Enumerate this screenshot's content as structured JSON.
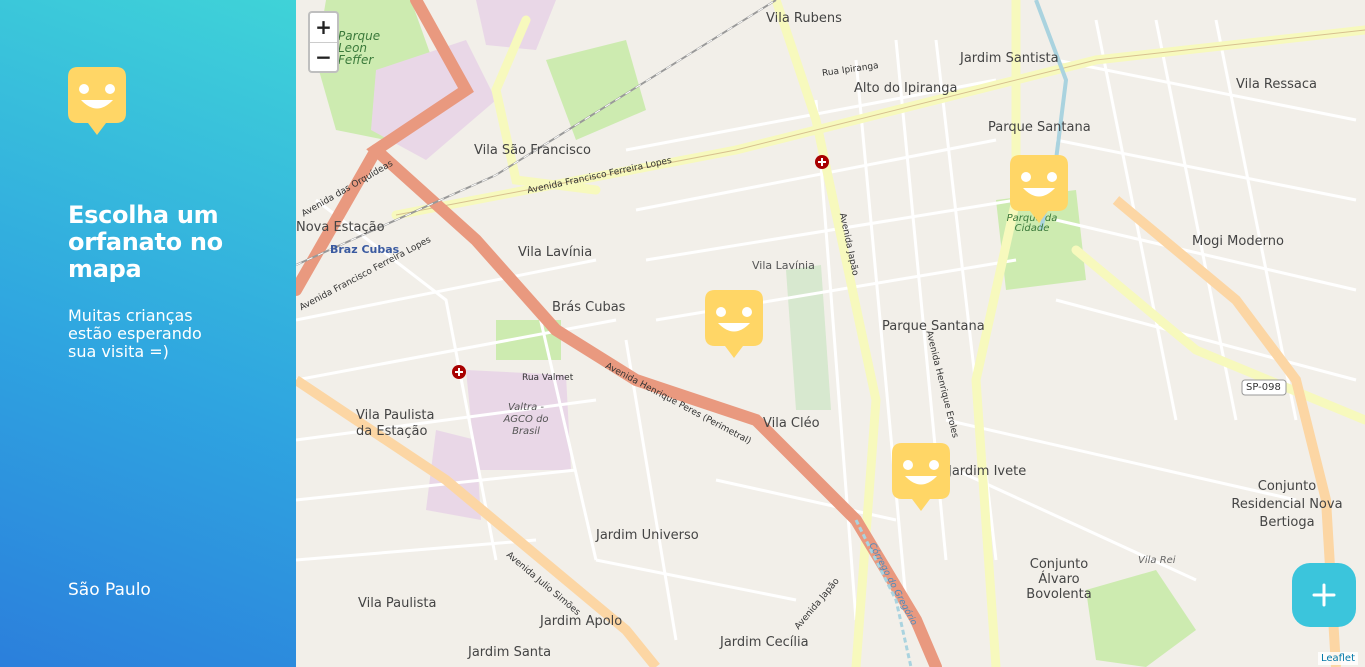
{
  "sidebar": {
    "title": "Escolha um orfanato no mapa",
    "subtitle": "Muitas crianças estão esperando sua visita =)",
    "city": "São Paulo"
  },
  "map": {
    "zoom_in_label": "+",
    "zoom_out_label": "−",
    "attribution": "Leaflet",
    "add_button_icon": "plus-icon",
    "marker_icon": "happy-face-pin-icon",
    "labels": {
      "vila_rubens": "Vila Rubens",
      "alto_ipiranga": "Alto do Ipiranga",
      "jardim_santista": "Jardim Santista",
      "vila_ressaca": "Vila Ressaca",
      "parque_santana_1": "Parque Santana",
      "parque_leon": "Parque Leon Feffer",
      "vila_sao_francisco": "Vila São Francisco",
      "nova_estacao": "Nova Estação",
      "braz_cubas_station": "Braz Cubas",
      "vila_lavinia": "Vila Lavínia",
      "vila_lavinia_2": "Vila Lavínia",
      "bras_cubas": "Brás Cubas",
      "mogi_moderno": "Mogi Moderno",
      "parque_santana_2": "Parque Santana",
      "parque_da_cidade": "Parque da Cidade",
      "vila_paulista_estacao": "Vila Paulista da Estação",
      "valtra": "Valtra - AGCO do Brasil",
      "vila_cleo": "Vila Cléo",
      "jardim_ivete": "Jardim Ivete",
      "conjunto_residencial": "Conjunto Residencial Nova Bertioga",
      "jardim_universo": "Jardim Universo",
      "conjunto_alvaro": "Conjunto Álvaro Bovolenta",
      "vila_paulista": "Vila Paulista",
      "jardim_apolo": "Jardim Apolo",
      "jardim_cecilia": "Jardim Cecília",
      "jardim_santa": "Jardim Santa",
      "vila_rei": "Vila Rei",
      "sp098": "SP-098",
      "rua_ipiranga": "Rua Ipiranga",
      "av_francisco_ferreira_lopes": "Avenida Francisco Ferreira Lopes",
      "av_francisco_ferreira_lopes_2": "Avenida Francisco Ferreira Lopes",
      "av_henrique_peres": "Avenida Henrique Peres (Perimetral)",
      "av_japao": "Avenida Japão",
      "av_japao_2": "Avenida Japão",
      "av_julio_simoes": "Avenida Julio Simões",
      "av_henrique_eroles": "Avenida Henrique Eroles",
      "corrego_gregorio": "Córrego do Gregório",
      "rua_valmet": "Rua Valmet",
      "av_das_orquideas": "Avenida das Orquídeas"
    }
  }
}
